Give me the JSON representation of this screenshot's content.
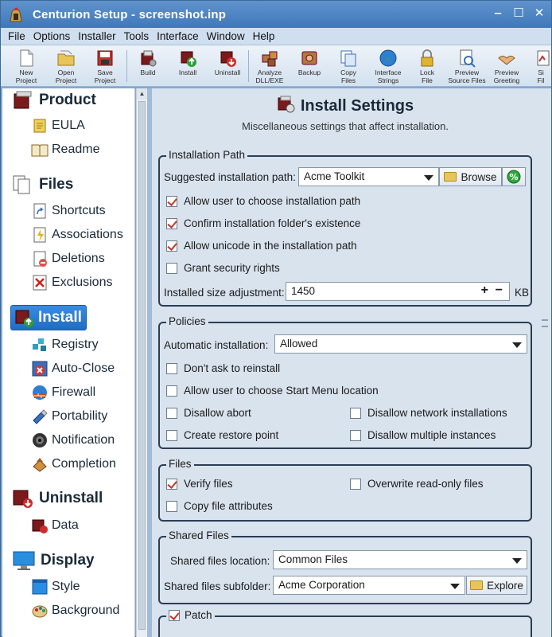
{
  "window": {
    "title": "Centurion Setup - screenshot.inp"
  },
  "menu": [
    "File",
    "Options",
    "Installer",
    "Tools",
    "Interface",
    "Window",
    "Help"
  ],
  "toolbar": [
    {
      "l1": "New",
      "l2": "Project",
      "icon": "new-project-icon"
    },
    {
      "l1": "Open",
      "l2": "Project",
      "icon": "open-project-icon"
    },
    {
      "l1": "Save",
      "l2": "Project",
      "icon": "save-project-icon"
    },
    {
      "l1": "",
      "l2": "Build",
      "icon": "build-icon"
    },
    {
      "l1": "",
      "l2": "Install",
      "icon": "install-icon"
    },
    {
      "l1": "",
      "l2": "Uninstall",
      "icon": "uninstall-icon"
    },
    {
      "l1": "Analyze",
      "l2": "DLL/EXE",
      "icon": "analyze-icon"
    },
    {
      "l1": "",
      "l2": "Backup",
      "icon": "backup-icon"
    },
    {
      "l1": "Copy",
      "l2": "Files",
      "icon": "copy-files-icon"
    },
    {
      "l1": "Interface",
      "l2": "Strings",
      "icon": "globe-icon"
    },
    {
      "l1": "Lock",
      "l2": "File",
      "icon": "lock-icon"
    },
    {
      "l1": "Preview",
      "l2": "Source Files",
      "icon": "preview-source-icon"
    },
    {
      "l1": "Preview",
      "l2": "Greeting",
      "icon": "preview-greeting-icon"
    },
    {
      "l1": "Si",
      "l2": "Fil",
      "icon": "sign-icon"
    }
  ],
  "sidebar": {
    "product": {
      "label": "Product",
      "items": [
        "EULA",
        "Readme"
      ]
    },
    "files": {
      "label": "Files",
      "items": [
        "Shortcuts",
        "Associations",
        "Deletions",
        "Exclusions"
      ]
    },
    "install": {
      "label": "Install",
      "items": [
        "Registry",
        "Auto-Close",
        "Firewall",
        "Portability",
        "Notification",
        "Completion"
      ]
    },
    "uninstall": {
      "label": "Uninstall",
      "items": [
        "Data"
      ]
    },
    "display": {
      "label": "Display",
      "items": [
        "Style",
        "Background"
      ]
    }
  },
  "header": {
    "title": "Install Settings",
    "subtitle": "Miscellaneous settings that affect installation."
  },
  "installation_path": {
    "title": "Installation Path",
    "suggested_label": "Suggested installation path:",
    "suggested_value": "Acme Toolkit",
    "browse": "Browse",
    "allow_choose": "Allow user to choose installation path",
    "confirm_exists": "Confirm installation folder's existence",
    "allow_unicode": "Allow unicode in the installation path",
    "grant_security": "Grant security rights",
    "size_label": "Installed size adjustment:",
    "size_value": "1450",
    "size_unit": "KB",
    "plus": "+",
    "minus": "−"
  },
  "policies": {
    "title": "Policies",
    "auto_label": "Automatic installation:",
    "auto_value": "Allowed",
    "dont_ask": "Don't ask to reinstall",
    "allow_start_menu": "Allow user to choose Start Menu location",
    "disallow_abort": "Disallow abort",
    "disallow_network": "Disallow network installations",
    "restore_point": "Create restore point",
    "disallow_multiple": "Disallow multiple instances"
  },
  "files": {
    "title": "Files",
    "verify": "Verify files",
    "overwrite_ro": "Overwrite read-only files",
    "copy_attr": "Copy file attributes"
  },
  "shared": {
    "title": "Shared Files",
    "location_label": "Shared files location:",
    "location_value": "Common Files",
    "subfolder_label": "Shared files subfolder:",
    "subfolder_value": "Acme Corporation",
    "explore": "Explore"
  },
  "patch": {
    "title": "Patch"
  }
}
